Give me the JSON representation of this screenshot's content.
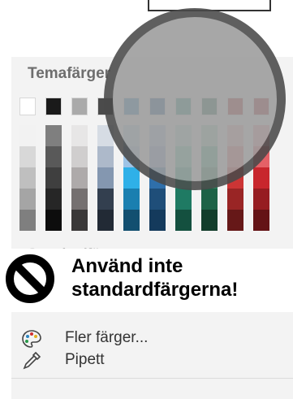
{
  "theme_colors_title": "Temafärger",
  "standard_colors_title": "Standardfärger",
  "theme_row": [
    "#ffffff",
    "#1a1a1a",
    "#aaaaaa",
    "#4b4b4b",
    "#2e86c1",
    "#1f5f99",
    "#2a9484",
    "#236b53",
    "#b22e2e",
    "#a6272b"
  ],
  "shade_columns": [
    [
      "#f2f2f2",
      "#d8d8d8",
      "#bfbfbf",
      "#a5a5a5",
      "#7f7f7f"
    ],
    [
      "#7f7f7f",
      "#595959",
      "#3f3f3f",
      "#262626",
      "#0d0d0d"
    ],
    [
      "#e7e6e6",
      "#d0cece",
      "#aeaaaa",
      "#757070",
      "#3a3838"
    ],
    [
      "#d6dce4",
      "#adb9ca",
      "#8497b0",
      "#333f4f",
      "#222a35"
    ],
    [
      "#bdd7ee",
      "#9dc3e6",
      "#2fb0e8",
      "#1a7fb0",
      "#124f70"
    ],
    [
      "#b4c7e7",
      "#8faadc",
      "#2f6faa",
      "#1f4e79",
      "#143a5c"
    ],
    [
      "#b6e3d6",
      "#6cd0b0",
      "#2aa789",
      "#1f7a63",
      "#14503f"
    ],
    [
      "#a8dcc2",
      "#4fbb8c",
      "#2b8a61",
      "#1d6246",
      "#123d2b"
    ],
    [
      "#f4b6b6",
      "#ea7373",
      "#cc3535",
      "#992525",
      "#661818"
    ],
    [
      "#f2a4a8",
      "#e56167",
      "#c8262d",
      "#961c21",
      "#641316"
    ]
  ],
  "standard_row": [
    "#c00000",
    "#ff0000",
    "#ffc000",
    "#ffff00",
    "#92d050",
    "#00b050",
    "#00b0f0",
    "#0070c0",
    "#002060",
    "#7030a0"
  ],
  "warning_line1": "Använd inte",
  "warning_line2": "standardfärgerna!",
  "more_colors_label": "Fler färger...",
  "eyedropper_label": "Pipett",
  "icons": {
    "no_sign": "prohibited-icon",
    "palette": "palette-icon",
    "eyedropper": "eyedropper-icon"
  }
}
